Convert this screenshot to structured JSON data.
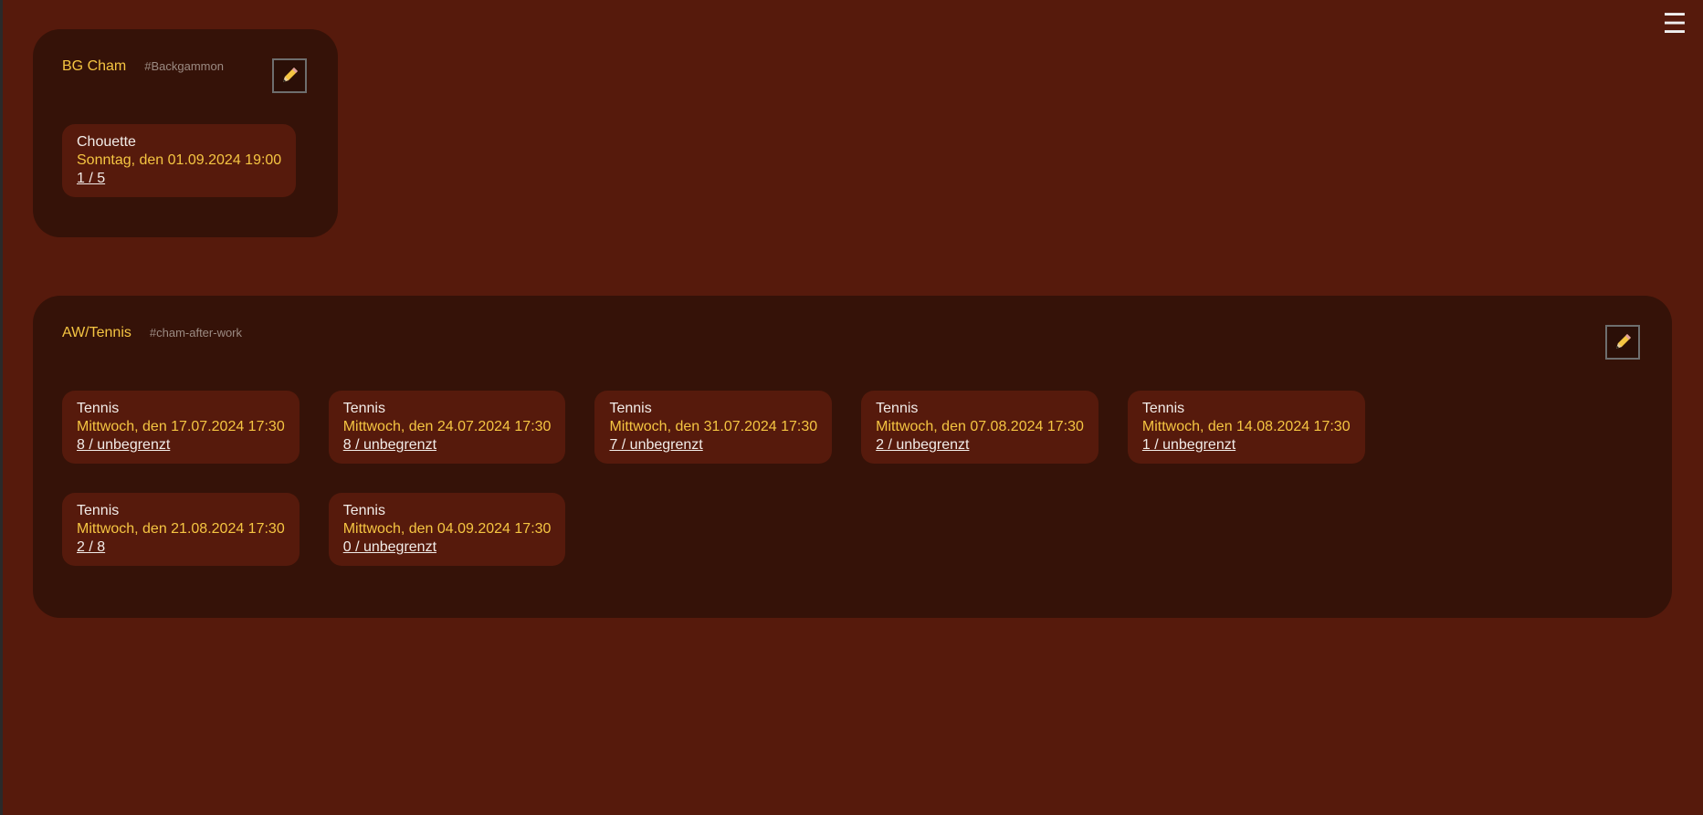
{
  "menu": {
    "icon": "hamburger-menu-icon",
    "glyph": "☰"
  },
  "groups": [
    {
      "title": "BG Cham",
      "tag": "#Backgammon",
      "edit_icon": "pencil-icon",
      "events": [
        {
          "name": "Chouette",
          "date": "Sonntag, den 01.09.2024 19:00",
          "count": "1 / 5"
        }
      ]
    },
    {
      "title": "AW/Tennis",
      "tag": "#cham-after-work",
      "edit_icon": "pencil-icon",
      "events": [
        {
          "name": "Tennis",
          "date": "Mittwoch, den 17.07.2024 17:30",
          "count": "8 / unbegrenzt"
        },
        {
          "name": "Tennis",
          "date": "Mittwoch, den 24.07.2024 17:30",
          "count": "8 / unbegrenzt"
        },
        {
          "name": "Tennis",
          "date": "Mittwoch, den 31.07.2024 17:30",
          "count": "7 / unbegrenzt"
        },
        {
          "name": "Tennis",
          "date": "Mittwoch, den 07.08.2024 17:30",
          "count": "2 / unbegrenzt"
        },
        {
          "name": "Tennis",
          "date": "Mittwoch, den 14.08.2024 17:30",
          "count": "1 / unbegrenzt"
        },
        {
          "name": "Tennis",
          "date": "Mittwoch, den 21.08.2024 17:30",
          "count": "2 / 8"
        },
        {
          "name": "Tennis",
          "date": "Mittwoch, den 04.09.2024 17:30",
          "count": "0 / unbegrenzt"
        }
      ]
    }
  ],
  "colors": {
    "page_bg": "#561a0c",
    "group_bg": "#351208",
    "accent": "#f5c542",
    "tag": "#9b8a82",
    "text": "#f2ece8"
  }
}
